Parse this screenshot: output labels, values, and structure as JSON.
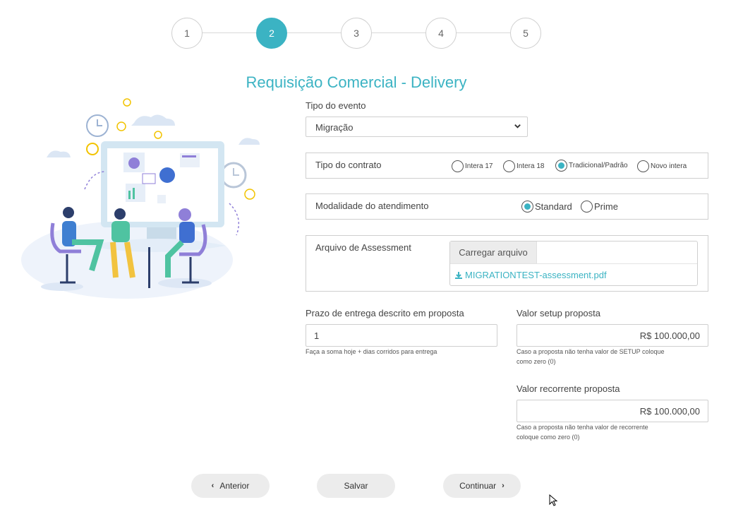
{
  "stepper": {
    "steps": [
      "1",
      "2",
      "3",
      "4",
      "5"
    ],
    "active_index": 1
  },
  "page": {
    "title": "Requisição Comercial - Delivery"
  },
  "form": {
    "tipo_evento": {
      "label": "Tipo do evento",
      "value": "Migração"
    },
    "tipo_contrato": {
      "label": "Tipo do contrato",
      "options": [
        "Intera 17",
        "Intera 18",
        "Tradicional/Padrão",
        "Novo intera"
      ],
      "selected": "Tradicional/Padrão"
    },
    "modalidade": {
      "label": "Modalidade do atendimento",
      "options": [
        "Standard",
        "Prime"
      ],
      "selected": "Standard"
    },
    "arquivo": {
      "label": "Arquivo de Assessment",
      "button_label": "Carregar arquivo",
      "file_name": "MIGRATIONTEST-assessment.pdf"
    },
    "prazo": {
      "label": "Prazo de entrega descrito em proposta",
      "value": "1",
      "help": "Faça a soma hoje + dias corridos para entrega"
    },
    "valor_setup": {
      "label": "Valor setup proposta",
      "value": "R$ 100.000,00",
      "help_line1": "Caso a proposta não tenha valor de SETUP coloque",
      "help_line2": "como zero (0)"
    },
    "valor_recorrente": {
      "label": "Valor recorrente proposta",
      "value": "R$ 100.000,00",
      "help_line1": "Caso a proposta não tenha valor de recorrente",
      "help_line2": "coloque como zero (0)"
    }
  },
  "footer": {
    "anterior": "Anterior",
    "salvar": "Salvar",
    "continuar": "Continuar"
  },
  "colors": {
    "accent": "#3bb3c3",
    "border": "#cfcfcf",
    "button_bg": "#ececec"
  },
  "icons": [
    "chevron-down-icon",
    "download-icon",
    "chevron-left-icon",
    "chevron-right-icon",
    "mouse-cursor-icon"
  ]
}
